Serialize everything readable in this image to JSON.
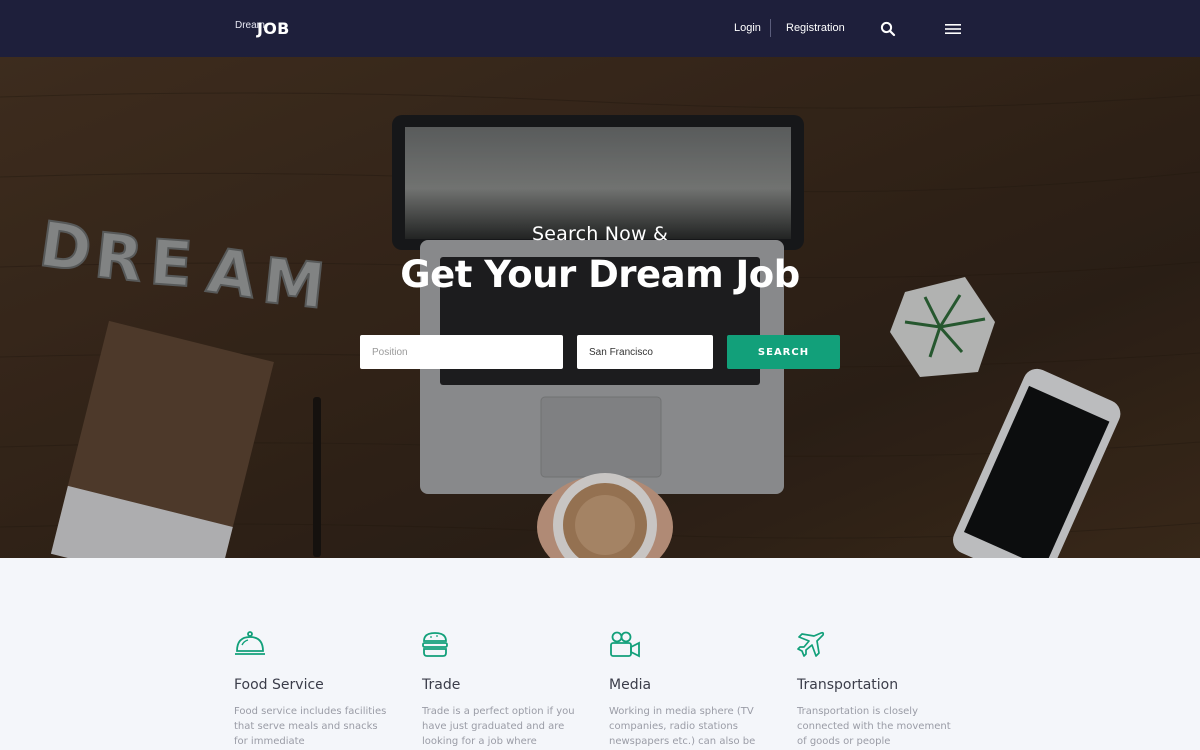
{
  "header": {
    "logo_small": "Dream",
    "logo_big": "JOB",
    "login_label": "Login",
    "register_label": "Registration",
    "search_icon": "search-icon",
    "menu_icon": "hamburger-menu-icon"
  },
  "hero": {
    "pre_title": "Search Now &",
    "title": "Get Your Dream Job",
    "position_placeholder": "Position",
    "location_value": "San Francisco",
    "search_label": "SEARCH",
    "background_letters": "DREAM"
  },
  "categories": [
    {
      "icon": "food-cloche-icon",
      "title": "Food Service",
      "description": "Food service includes facilities that serve meals and snacks for immediate"
    },
    {
      "icon": "burger-icon",
      "title": "Trade",
      "description": "Trade is a perfect option if you have just graduated and are looking for a job where"
    },
    {
      "icon": "video-camera-icon",
      "title": "Media",
      "description": "Working in media sphere (TV companies, radio stations newspapers etc.) can also be"
    },
    {
      "icon": "airplane-icon",
      "title": "Transportation",
      "description": "Transportation is closely connected with the movement of goods or people"
    }
  ],
  "colors": {
    "header_bg": "#1e1f3b",
    "accent": "#12a07a",
    "section_bg": "#f4f6fa"
  }
}
